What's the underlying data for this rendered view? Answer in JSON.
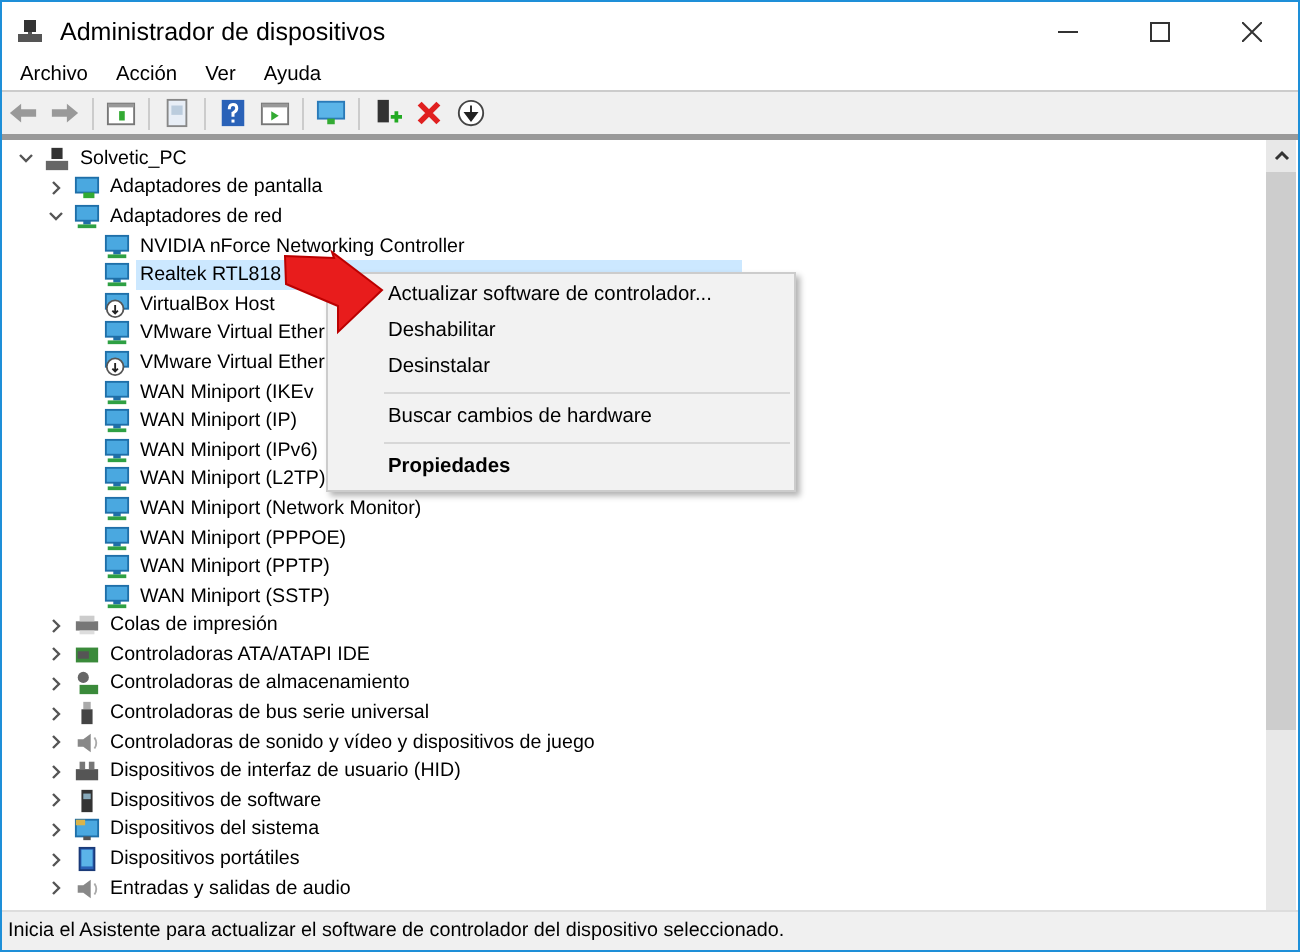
{
  "window": {
    "title": "Administrador de dispositivos"
  },
  "menu": [
    "Archivo",
    "Acción",
    "Ver",
    "Ayuda"
  ],
  "toolbar": [
    {
      "kind": "back"
    },
    {
      "kind": "forward"
    },
    {
      "kind": "sep"
    },
    {
      "kind": "panel"
    },
    {
      "kind": "sep"
    },
    {
      "kind": "page"
    },
    {
      "kind": "sep"
    },
    {
      "kind": "help"
    },
    {
      "kind": "panel-play"
    },
    {
      "kind": "sep"
    },
    {
      "kind": "monitor"
    },
    {
      "kind": "sep"
    },
    {
      "kind": "add-driver"
    },
    {
      "kind": "remove"
    },
    {
      "kind": "download"
    }
  ],
  "tree": [
    {
      "label": "Solvetic_PC",
      "kind": "computer",
      "expanded": true,
      "selected": false,
      "children": [
        {
          "label": "Adaptadores de pantalla",
          "kind": "display",
          "expanded": false,
          "selected": false
        },
        {
          "label": "Adaptadores de red",
          "kind": "network",
          "expanded": true,
          "selected": false,
          "children": [
            {
              "label": "NVIDIA nForce Networking Controller",
              "kind": "network",
              "selected": false
            },
            {
              "label": "Realtek RTL818",
              "kind": "network",
              "selected": true
            },
            {
              "label": "VirtualBox Host",
              "kind": "network-disabled",
              "selected": false
            },
            {
              "label": "VMware Virtual Ether",
              "kind": "network",
              "selected": false
            },
            {
              "label": "VMware Virtual Ether",
              "kind": "network-disabled",
              "selected": false
            },
            {
              "label": "WAN Miniport (IKEv",
              "kind": "network",
              "selected": false
            },
            {
              "label": "WAN Miniport (IP)",
              "kind": "network",
              "selected": false
            },
            {
              "label": "WAN Miniport (IPv6)",
              "kind": "network",
              "selected": false
            },
            {
              "label": "WAN Miniport (L2TP)",
              "kind": "network",
              "selected": false
            },
            {
              "label": "WAN Miniport (Network Monitor)",
              "kind": "network",
              "selected": false
            },
            {
              "label": "WAN Miniport (PPPOE)",
              "kind": "network",
              "selected": false
            },
            {
              "label": "WAN Miniport (PPTP)",
              "kind": "network",
              "selected": false
            },
            {
              "label": "WAN Miniport (SSTP)",
              "kind": "network",
              "selected": false
            }
          ]
        },
        {
          "label": "Colas de impresión",
          "kind": "printer",
          "expanded": false,
          "selected": false
        },
        {
          "label": "Controladoras ATA/ATAPI IDE",
          "kind": "chip",
          "expanded": false,
          "selected": false
        },
        {
          "label": "Controladoras de almacenamiento",
          "kind": "storage",
          "expanded": false,
          "selected": false
        },
        {
          "label": "Controladoras de bus serie universal",
          "kind": "usb",
          "expanded": false,
          "selected": false
        },
        {
          "label": "Controladoras de sonido y vídeo y dispositivos de juego",
          "kind": "speaker",
          "expanded": false,
          "selected": false
        },
        {
          "label": "Dispositivos de interfaz de usuario (HID)",
          "kind": "hid",
          "expanded": false,
          "selected": false
        },
        {
          "label": "Dispositivos de software",
          "kind": "software",
          "expanded": false,
          "selected": false
        },
        {
          "label": "Dispositivos del sistema",
          "kind": "system",
          "expanded": false,
          "selected": false
        },
        {
          "label": "Dispositivos portátiles",
          "kind": "portable",
          "expanded": false,
          "selected": false
        },
        {
          "label": "Entradas y salidas de audio",
          "kind": "speaker",
          "expanded": false,
          "selected": false
        }
      ]
    }
  ],
  "context_menu": [
    {
      "label": "Actualizar software de controlador...",
      "default": false
    },
    {
      "label": "Deshabilitar",
      "default": false
    },
    {
      "label": "Desinstalar",
      "default": false
    },
    {
      "kind": "separator"
    },
    {
      "label": "Buscar cambios de hardware",
      "default": false
    },
    {
      "kind": "separator"
    },
    {
      "label": "Propiedades",
      "default": true
    }
  ],
  "status_bar": "Inicia el Asistente para actualizar el software de controlador del dispositivo seleccionado."
}
